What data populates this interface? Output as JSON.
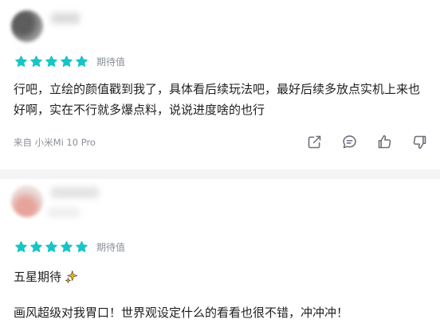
{
  "reviews": [
    {
      "rating_label": "期待值",
      "stars": 5,
      "content": "行吧，立绘的颜值戳到我了，具体看后续玩法吧，最好后续多放点实机上来也好啊，实在不行就多爆点料，说说进度啥的也行",
      "device": "来自 小米Mi 10 Pro",
      "actions": [
        "share-icon",
        "comment-icon",
        "like-icon",
        "dislike-icon"
      ]
    },
    {
      "rating_label": "期待值",
      "stars": 5,
      "line1": "五星期待",
      "line2": "画风超级对我胃口！世界观设定什么的看看也很不错，冲冲冲！"
    }
  ],
  "colors": {
    "star": "#17c5c6",
    "muted_text": "#8a8f99",
    "separator": "#f3f4f6"
  }
}
